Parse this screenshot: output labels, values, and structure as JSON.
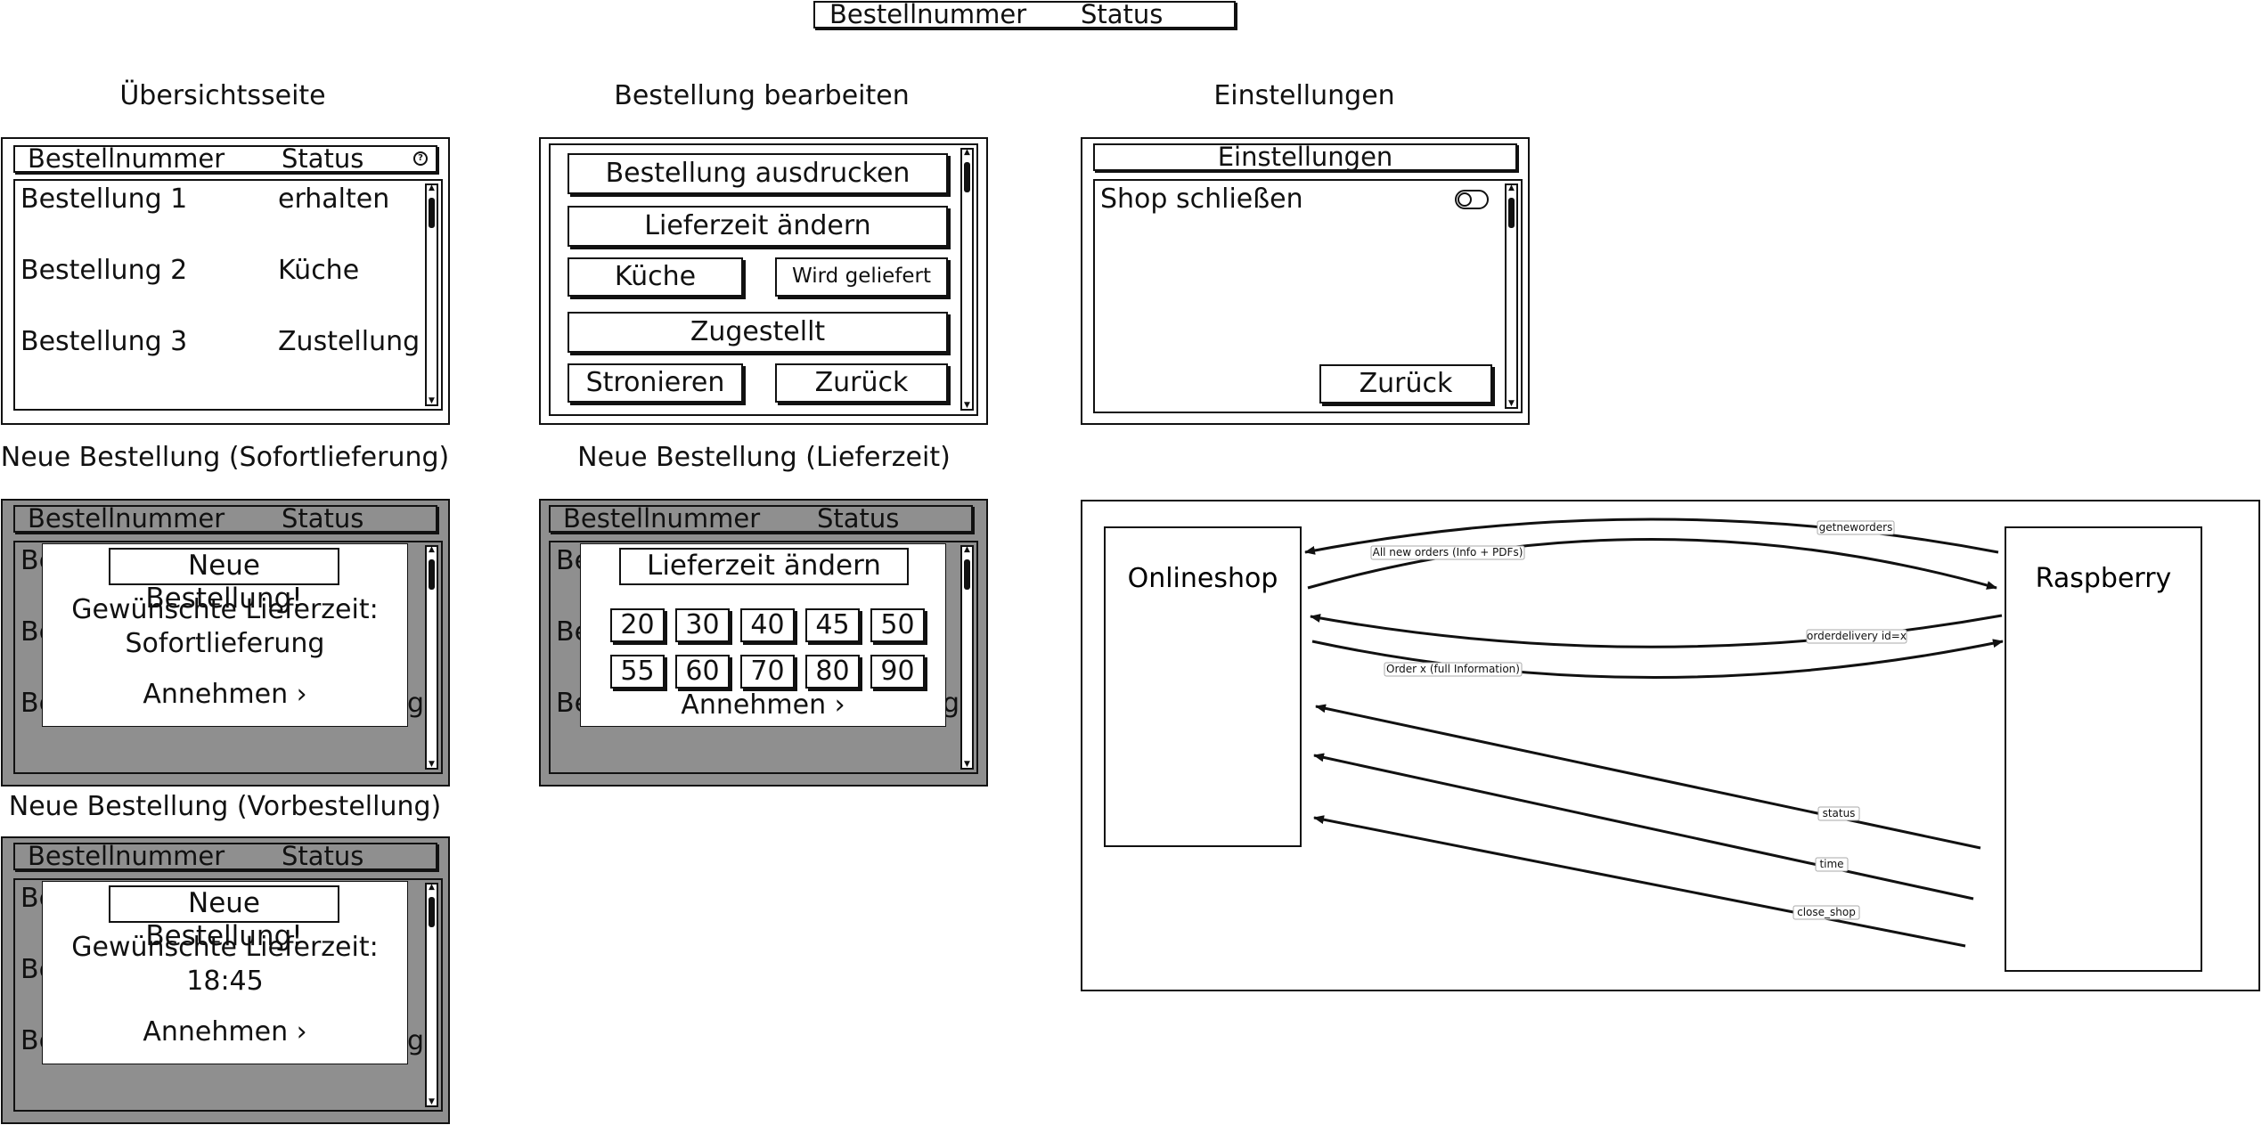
{
  "top_header": {
    "col1": "Bestellnummer",
    "col2": "Status"
  },
  "overview": {
    "caption": "Übersichtsseite",
    "col1": "Bestellnummer",
    "col2": "Status",
    "rows": [
      {
        "name": "Bestellung 1",
        "status": "erhalten"
      },
      {
        "name": "Bestellung 2",
        "status": "Küche"
      },
      {
        "name": "Bestellung 3",
        "status": "Zustellung"
      }
    ]
  },
  "edit": {
    "caption": "Bestellung bearbeiten",
    "print": "Bestellung ausdrucken",
    "change_time": "Lieferzeit ändern",
    "kitchen": "Küche",
    "delivering": "Wird geliefert",
    "delivered": "Zugestellt",
    "cancel": "Stronieren",
    "back": "Zurück"
  },
  "settings": {
    "caption": "Einstellungen",
    "header": "Einstellungen",
    "close_shop": "Shop schließen",
    "back": "Zurück"
  },
  "new_immediate": {
    "caption": "Neue Bestellung (Sofortlieferung)",
    "col1": "Bestellnummer",
    "col2": "Status",
    "bg_row_start": "Be",
    "bg_row_end": "g",
    "title": "Neue Bestellung!",
    "wish_label": "Gewünschte Lieferzeit:",
    "wish_value": "Sofortlieferung",
    "accept": "Annehmen ›"
  },
  "new_time": {
    "caption": "Neue Bestellung (Lieferzeit)",
    "col1": "Bestellnummer",
    "col2": "Status",
    "bg_row_start": "Be",
    "bg_row_end": "g",
    "title": "Lieferzeit ändern",
    "times": [
      "20",
      "30",
      "40",
      "45",
      "50",
      "55",
      "60",
      "70",
      "80",
      "90"
    ],
    "accept": "Annehmen ›"
  },
  "new_preorder": {
    "caption": "Neue Bestellung (Vorbestellung)",
    "col1": "Bestellnummer",
    "col2": "Status",
    "bg_row_start": "Be",
    "bg_row_end": "g",
    "title": "Neue Bestellung!",
    "wish_label": "Gewünschte Lieferzeit:",
    "wish_value": "18:45",
    "accept": "Annehmen ›"
  },
  "sequence": {
    "left": "Onlineshop",
    "right": "Raspberry",
    "messages": [
      {
        "label": "getneworders",
        "direction": "to-left"
      },
      {
        "label": "All new orders (Info + PDFs)",
        "direction": "to-right"
      },
      {
        "label": "orderdelivery id=x",
        "direction": "to-left"
      },
      {
        "label": "Order x (full Information)",
        "direction": "to-right"
      },
      {
        "label": "status",
        "direction": "to-left"
      },
      {
        "label": "time",
        "direction": "to-left"
      },
      {
        "label": "close_shop",
        "direction": "to-left"
      }
    ]
  }
}
